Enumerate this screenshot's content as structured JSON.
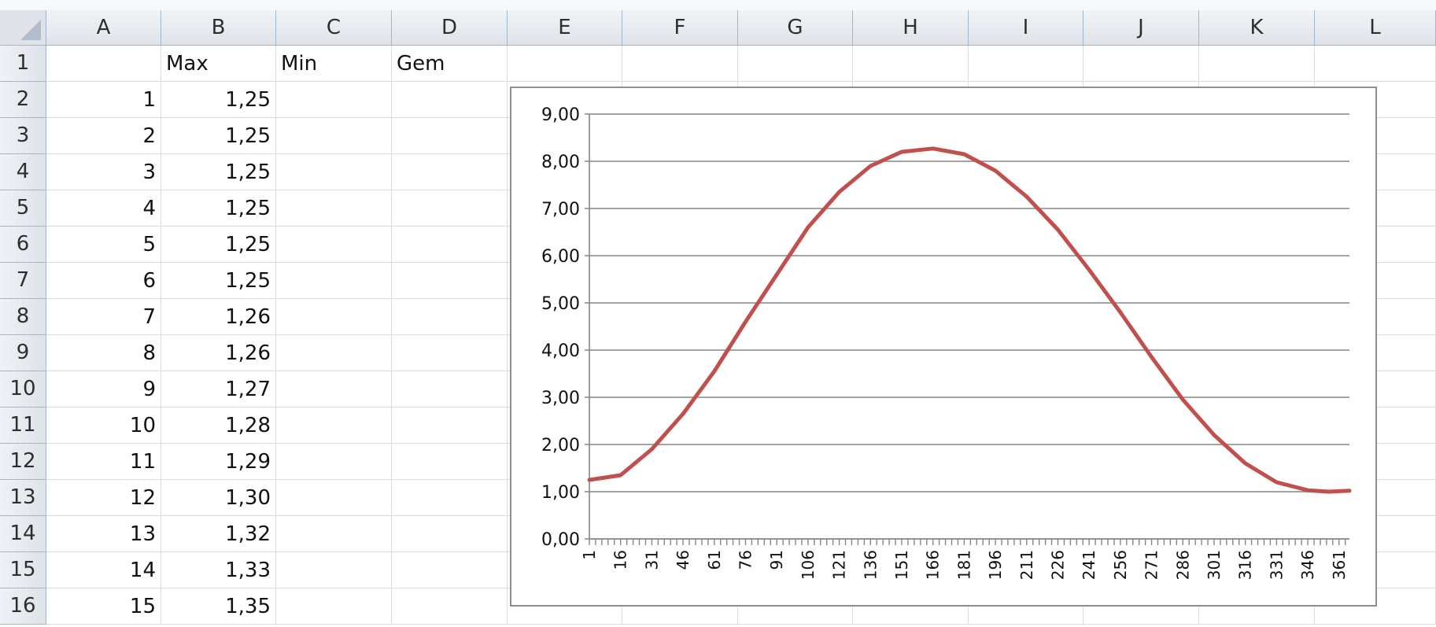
{
  "columns": [
    "A",
    "B",
    "C",
    "D",
    "E",
    "F",
    "G",
    "H",
    "I",
    "J",
    "K",
    "L"
  ],
  "rows": [
    "1",
    "2",
    "3",
    "4",
    "5",
    "6",
    "7",
    "8",
    "9",
    "10",
    "11",
    "12",
    "13",
    "14",
    "15",
    "16"
  ],
  "headers": {
    "b1": "Max",
    "c1": "Min",
    "d1": "Gem"
  },
  "col_a": [
    "1",
    "2",
    "3",
    "4",
    "5",
    "6",
    "7",
    "8",
    "9",
    "10",
    "11",
    "12",
    "13",
    "14",
    "15"
  ],
  "col_b": [
    "1,25",
    "1,25",
    "1,25",
    "1,25",
    "1,25",
    "1,25",
    "1,26",
    "1,26",
    "1,27",
    "1,28",
    "1,29",
    "1,30",
    "1,32",
    "1,33",
    "1,35"
  ],
  "colors": {
    "series": "#c0504d",
    "gridline": "#868686",
    "header_border": "#9eb6ce"
  },
  "chart_data": {
    "type": "line",
    "title": "",
    "xlabel": "",
    "ylabel": "",
    "ylim": [
      0,
      9
    ],
    "y_ticks": [
      "0,00",
      "1,00",
      "2,00",
      "3,00",
      "4,00",
      "5,00",
      "6,00",
      "7,00",
      "8,00",
      "9,00"
    ],
    "x_ticks": [
      "1",
      "16",
      "31",
      "46",
      "61",
      "76",
      "91",
      "106",
      "121",
      "136",
      "151",
      "166",
      "181",
      "196",
      "211",
      "226",
      "241",
      "256",
      "271",
      "286",
      "301",
      "316",
      "331",
      "346",
      "361"
    ],
    "x_range": [
      1,
      366
    ],
    "grid": true,
    "legend": "none",
    "series": [
      {
        "x": [
          1,
          16,
          31,
          46,
          61,
          76,
          91,
          106,
          121,
          136,
          151,
          166,
          181,
          196,
          211,
          226,
          241,
          256,
          271,
          286,
          301,
          316,
          331,
          346,
          356,
          366
        ],
        "values": [
          1.25,
          1.35,
          1.9,
          2.65,
          3.55,
          4.6,
          5.6,
          6.6,
          7.35,
          7.9,
          8.2,
          8.27,
          8.15,
          7.8,
          7.25,
          6.55,
          5.7,
          4.8,
          3.85,
          2.95,
          2.2,
          1.6,
          1.2,
          1.03,
          1.0,
          1.02
        ]
      }
    ]
  }
}
